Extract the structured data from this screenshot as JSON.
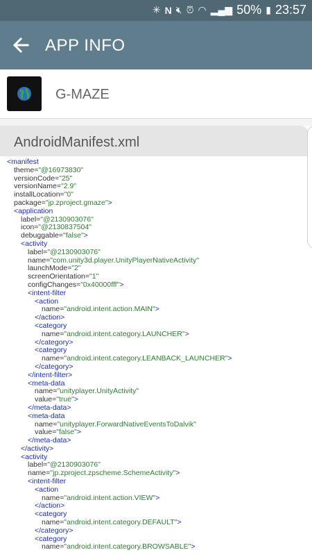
{
  "status": {
    "battery": "50%",
    "time": "23:57",
    "icons": [
      "bluetooth-icon",
      "nfc-icon",
      "mute-icon",
      "alarm-icon",
      "wifi-icon",
      "signal-icon",
      "battery-icon"
    ]
  },
  "appbar": {
    "title": "APP INFO",
    "back_icon": "arrow-left-icon"
  },
  "app": {
    "name": "G-MAZE",
    "icon": "globe-icon"
  },
  "file": {
    "title": "AndroidManifest.xml"
  },
  "colors": {
    "statusbar": "#4f6874",
    "appbar": "#5f7d8c",
    "tag": "#1a2fb3",
    "value": "#2e7d32"
  },
  "code_lines": [
    {
      "i": 0,
      "t": "tag",
      "s": "<manifest"
    },
    {
      "i": 1,
      "t": "attr",
      "k": "theme=",
      "v": "\"@16973830\""
    },
    {
      "i": 1,
      "t": "attr",
      "k": "versionCode=",
      "v": "\"25\""
    },
    {
      "i": 1,
      "t": "attr",
      "k": "versionName=",
      "v": "\"2.9\""
    },
    {
      "i": 1,
      "t": "attr",
      "k": "installLocation=",
      "v": "\"0\""
    },
    {
      "i": 1,
      "t": "attr",
      "k": "package=",
      "v": "\"jp.zproject.gmaze\"",
      "e": ">"
    },
    {
      "i": 1,
      "t": "tag",
      "s": "<application"
    },
    {
      "i": 2,
      "t": "attr",
      "k": "label=",
      "v": "\"@2130903076\""
    },
    {
      "i": 2,
      "t": "attr",
      "k": "icon=",
      "v": "\"@2130837504\""
    },
    {
      "i": 2,
      "t": "attr",
      "k": "debuggable=",
      "v": "\"false\"",
      "e": ">"
    },
    {
      "i": 2,
      "t": "tag",
      "s": "<activity"
    },
    {
      "i": 3,
      "t": "attr",
      "k": "label=",
      "v": "\"@2130903076\""
    },
    {
      "i": 3,
      "t": "attr",
      "k": "name=",
      "v": "\"com.unity3d.player.UnityPlayerNativeActivity\""
    },
    {
      "i": 3,
      "t": "attr",
      "k": "launchMode=",
      "v": "\"2\""
    },
    {
      "i": 3,
      "t": "attr",
      "k": "screenOrientation=",
      "v": "\"1\""
    },
    {
      "i": 3,
      "t": "attr",
      "k": "configChanges=",
      "v": "\"0x40000fff\"",
      "e": ">"
    },
    {
      "i": 3,
      "t": "tag",
      "s": "<intent-filter"
    },
    {
      "i": 4,
      "t": "tag",
      "s": "<action"
    },
    {
      "i": 5,
      "t": "attr",
      "k": "name=",
      "v": "\"android.intent.action.MAIN\"",
      "e": ">"
    },
    {
      "i": 4,
      "t": "tag",
      "s": "</action>"
    },
    {
      "i": 4,
      "t": "tag",
      "s": "<category"
    },
    {
      "i": 5,
      "t": "attr",
      "k": "name=",
      "v": "\"android.intent.category.LAUNCHER\"",
      "e": ">"
    },
    {
      "i": 4,
      "t": "tag",
      "s": "</category>"
    },
    {
      "i": 4,
      "t": "tag",
      "s": "<category"
    },
    {
      "i": 5,
      "t": "attr",
      "k": "name=",
      "v": "\"android.intent.category.LEANBACK_LAUNCHER\"",
      "e": ">"
    },
    {
      "i": 4,
      "t": "tag",
      "s": "</category>"
    },
    {
      "i": 3,
      "t": "tag",
      "s": "</intent-filter>"
    },
    {
      "i": 3,
      "t": "tag",
      "s": "<meta-data"
    },
    {
      "i": 4,
      "t": "attr",
      "k": "name=",
      "v": "\"unityplayer.UnityActivity\""
    },
    {
      "i": 4,
      "t": "attr",
      "k": "value=",
      "v": "\"true\"",
      "e": ">"
    },
    {
      "i": 3,
      "t": "tag",
      "s": "</meta-data>"
    },
    {
      "i": 3,
      "t": "tag",
      "s": "<meta-data"
    },
    {
      "i": 4,
      "t": "attr",
      "k": "name=",
      "v": "\"unityplayer.ForwardNativeEventsToDalvik\""
    },
    {
      "i": 4,
      "t": "attr",
      "k": "value=",
      "v": "\"false\"",
      "e": ">"
    },
    {
      "i": 3,
      "t": "tag",
      "s": "</meta-data>"
    },
    {
      "i": 2,
      "t": "tag",
      "s": "</activity>"
    },
    {
      "i": 2,
      "t": "tag",
      "s": "<activity"
    },
    {
      "i": 3,
      "t": "attr",
      "k": "label=",
      "v": "\"@2130903076\""
    },
    {
      "i": 3,
      "t": "attr",
      "k": "name=",
      "v": "\"jp.zproject.zpscheme.SchemeActivity\"",
      "e": ">"
    },
    {
      "i": 3,
      "t": "tag",
      "s": "<intent-filter"
    },
    {
      "i": 4,
      "t": "tag",
      "s": "<action"
    },
    {
      "i": 5,
      "t": "attr",
      "k": "name=",
      "v": "\"android.intent.action.VIEW\"",
      "e": ">"
    },
    {
      "i": 4,
      "t": "tag",
      "s": "</action>"
    },
    {
      "i": 4,
      "t": "tag",
      "s": "<category"
    },
    {
      "i": 5,
      "t": "attr",
      "k": "name=",
      "v": "\"android.intent.category.DEFAULT\"",
      "e": ">"
    },
    {
      "i": 4,
      "t": "tag",
      "s": "</category>"
    },
    {
      "i": 4,
      "t": "tag",
      "s": "<category"
    },
    {
      "i": 5,
      "t": "attr",
      "k": "name=",
      "v": "\"android.intent.category.BROWSABLE\"",
      "e": ">"
    }
  ]
}
